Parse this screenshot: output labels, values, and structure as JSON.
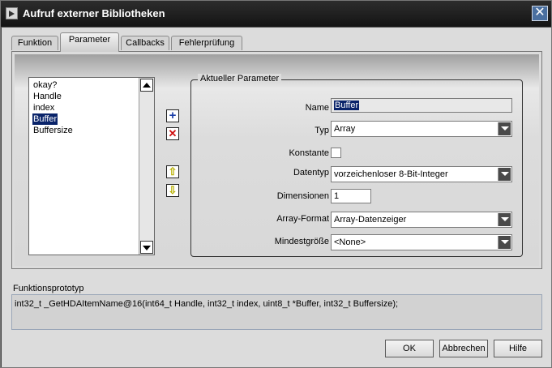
{
  "window": {
    "title": "Aufruf externer Bibliotheken",
    "close_label": "✕"
  },
  "tabs": [
    {
      "label": "Funktion"
    },
    {
      "label": "Parameter"
    },
    {
      "label": "Callbacks"
    },
    {
      "label": "Fehlerprüfung"
    }
  ],
  "parameter_list": {
    "items": [
      "okay?",
      "Handle",
      "index",
      "Buffer",
      "Buffersize"
    ],
    "selected": "Buffer"
  },
  "side_buttons": {
    "add": "+",
    "remove": "✕",
    "up": "⇧",
    "down": "⇩"
  },
  "current_parameter": {
    "legend": "Aktueller Parameter",
    "name_label": "Name",
    "name_value": "Buffer",
    "type_label": "Typ",
    "type_value": "Array",
    "constant_label": "Konstante",
    "datatype_label": "Datentyp",
    "datatype_value": "vorzeichenloser 8-Bit-Integer",
    "dimensions_label": "Dimensionen",
    "dimensions_value": "1",
    "array_format_label": "Array-Format",
    "array_format_value": "Array-Datenzeiger",
    "min_size_label": "Mindestgröße",
    "min_size_value": "<None>"
  },
  "prototype": {
    "label": "Funktionsprototyp",
    "text": "int32_t _GetHDAItemName@16(int64_t Handle, int32_t index, uint8_t *Buffer, int32_t Buffersize);"
  },
  "buttons": {
    "ok": "OK",
    "cancel": "Abbrechen",
    "help": "Hilfe"
  },
  "icons": {
    "add": "plus-icon",
    "remove": "x-icon",
    "up": "arrow-up-icon",
    "down": "arrow-down-icon",
    "dropdown": "chevron-down-icon",
    "app": "labview-icon",
    "close": "close-icon"
  },
  "colors": {
    "selection": "#0a246a",
    "add_icon": "#1a3ea8",
    "remove_icon": "#d01010",
    "arrow_icon": "#e8e000"
  }
}
